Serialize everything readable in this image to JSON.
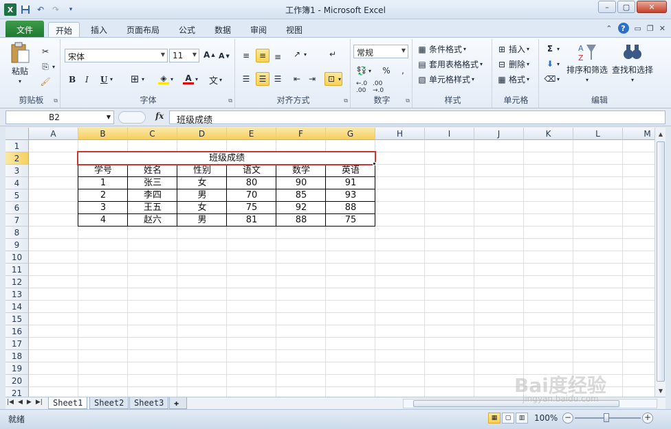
{
  "window": {
    "title": "工作簿1 - Microsoft Excel"
  },
  "qat": {
    "undo": "↶",
    "redo": "↷",
    "more": "▾"
  },
  "tabs": [
    {
      "label": "文件"
    },
    {
      "label": "开始"
    },
    {
      "label": "插入"
    },
    {
      "label": "页面布局"
    },
    {
      "label": "公式"
    },
    {
      "label": "数据"
    },
    {
      "label": "审阅"
    },
    {
      "label": "视图"
    }
  ],
  "ribbon": {
    "clipboard": {
      "label": "剪贴板",
      "paste": "粘贴"
    },
    "font": {
      "label": "字体",
      "name": "宋体",
      "size": "11",
      "bold": "B",
      "italic": "I",
      "underline": "U"
    },
    "alignment": {
      "label": "对齐方式"
    },
    "number": {
      "label": "数字",
      "format": "常规"
    },
    "styles": {
      "label": "样式",
      "conditional": "条件格式",
      "table": "套用表格格式",
      "cell": "单元格样式"
    },
    "cells": {
      "label": "单元格",
      "insert": "插入",
      "delete": "删除",
      "format": "格式"
    },
    "editing": {
      "label": "编辑",
      "sort": "排序和筛选",
      "find": "查找和选择"
    }
  },
  "formula_bar": {
    "name_box": "B2",
    "fx": "fx",
    "content": "班级成绩"
  },
  "columns": [
    "A",
    "B",
    "C",
    "D",
    "E",
    "F",
    "G",
    "H",
    "I",
    "J",
    "K",
    "L",
    "M"
  ],
  "rows": [
    "1",
    "2",
    "3",
    "4",
    "5",
    "6",
    "7",
    "8",
    "9",
    "10",
    "11",
    "12",
    "13",
    "14",
    "15",
    "16",
    "17",
    "18",
    "19",
    "20",
    "21"
  ],
  "sheet": {
    "title": "班级成绩",
    "headers": [
      "学号",
      "姓名",
      "性别",
      "语文",
      "数学",
      "英语"
    ],
    "records": [
      [
        "1",
        "张三",
        "女",
        "80",
        "90",
        "91"
      ],
      [
        "2",
        "李四",
        "男",
        "70",
        "85",
        "93"
      ],
      [
        "3",
        "王五",
        "女",
        "75",
        "92",
        "88"
      ],
      [
        "4",
        "赵六",
        "男",
        "81",
        "88",
        "75"
      ]
    ]
  },
  "sheet_tabs": [
    "Sheet1",
    "Sheet2",
    "Sheet3"
  ],
  "status": {
    "ready": "就绪",
    "zoom": "100%"
  },
  "watermark": {
    "text": "Bai度经验",
    "url": "jingyan.baidu.com"
  }
}
